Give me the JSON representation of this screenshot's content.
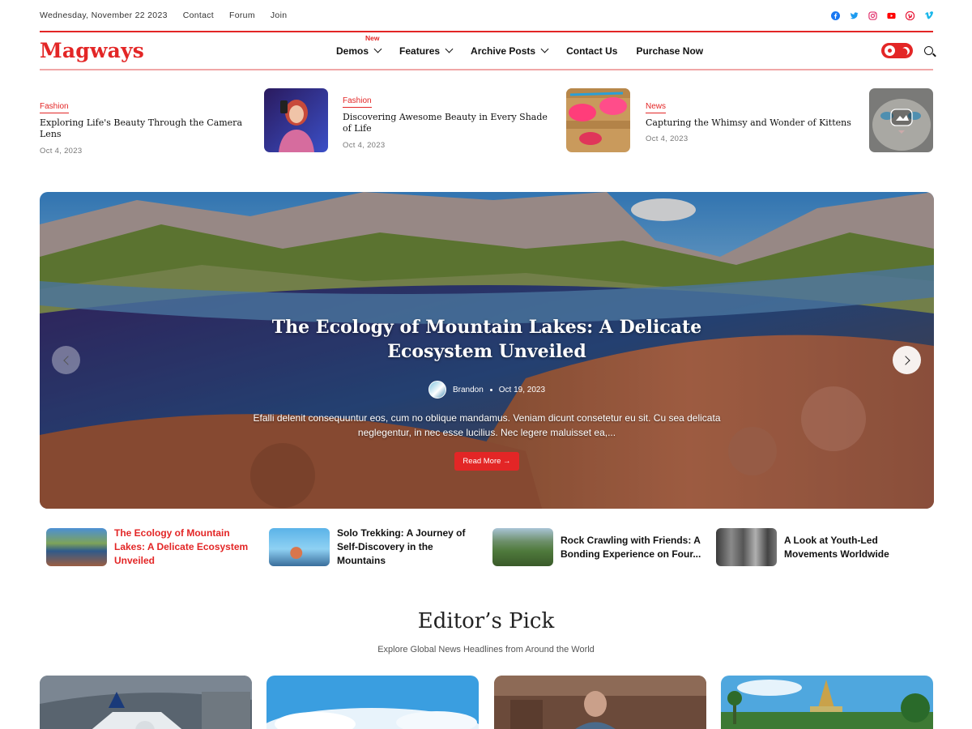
{
  "topbar": {
    "date": "Wednesday, November 22 2023",
    "links": [
      "Contact",
      "Forum",
      "Join"
    ],
    "social_icons": [
      "facebook-icon",
      "twitter-icon",
      "instagram-icon",
      "youtube-icon",
      "pinterest-icon",
      "vimeo-icon"
    ]
  },
  "header": {
    "logo": "Magways",
    "nav": [
      {
        "label": "Demos",
        "badge": "New",
        "dropdown": true
      },
      {
        "label": "Features",
        "dropdown": true
      },
      {
        "label": "Archive Posts",
        "dropdown": true
      },
      {
        "label": "Contact Us",
        "dropdown": false
      },
      {
        "label": "Purchase Now",
        "dropdown": false
      }
    ]
  },
  "trending": [
    {
      "category": "Fashion",
      "title": "Exploring Life's Beauty Through the Camera Lens",
      "date": "Oct 4, 2023"
    },
    {
      "category": "Fashion",
      "title": "Discovering Awesome Beauty in Every Shade of Life",
      "date": "Oct 4, 2023"
    },
    {
      "category": "News",
      "title": "Capturing the Whimsy and Wonder of Kittens",
      "date": "Oct 4, 2023"
    }
  ],
  "hero": {
    "title": "The Ecology of Mountain Lakes: A Delicate Ecosystem Unveiled",
    "author": "Brandon",
    "date": "Oct 19, 2023",
    "excerpt": "Efalli delenit consequuntur eos, cum no oblique mandamus. Veniam dicunt consetetur eu sit. Cu sea delicata neglegentur, in nec esse lucilius. Nec legere maluisset ea,...",
    "read_more": "Read More →"
  },
  "slider_thumbs": [
    "The Ecology of Mountain Lakes: A Delicate Ecosystem Unveiled",
    "Solo Trekking: A Journey of Self-Discovery in the Mountains",
    "Rock Crawling with Friends: A Bonding Experience on Four...",
    "A Look at Youth-Led Movements Worldwide"
  ],
  "editors_pick": {
    "title": "Editor’s Pick",
    "subtitle": "Explore Global News Headlines from Around the World"
  },
  "colors": {
    "accent": "#e32626"
  }
}
